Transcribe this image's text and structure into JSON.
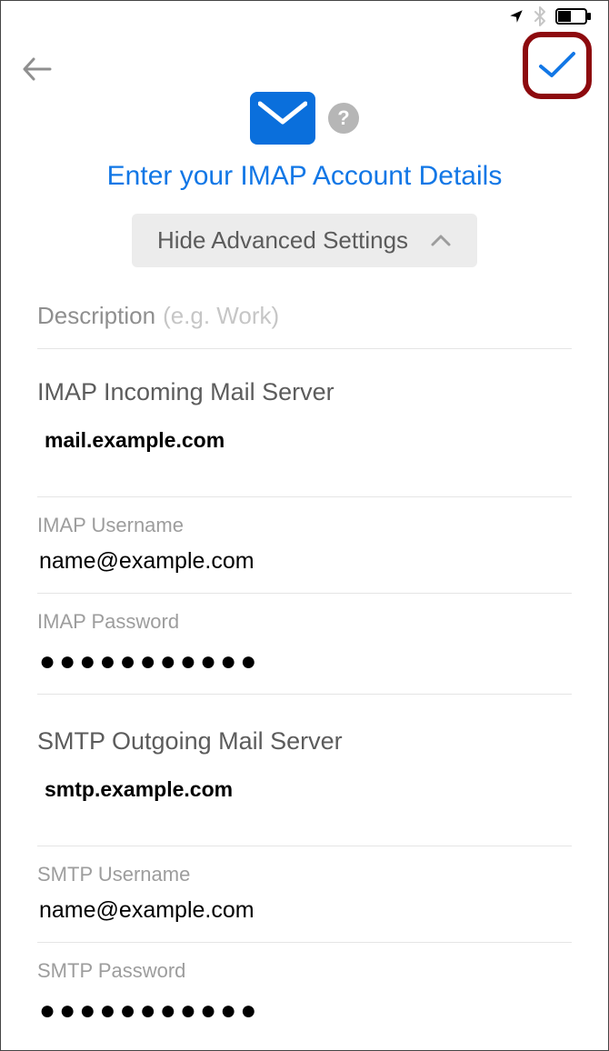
{
  "header": {
    "title": "Enter your IMAP Account Details",
    "toggle_label": "Hide Advanced Settings"
  },
  "description": {
    "label": "Description",
    "placeholder": "(e.g. Work)",
    "value": ""
  },
  "imap": {
    "section_title": "IMAP Incoming Mail Server",
    "host": "mail.example.com",
    "username_label": "IMAP Username",
    "username_value": "name@example.com",
    "password_label": "IMAP Password",
    "password_mask": "●●●●●●●●●●●"
  },
  "smtp": {
    "section_title": "SMTP Outgoing Mail Server",
    "host": "smtp.example.com",
    "username_label": "SMTP Username",
    "username_value": "name@example.com",
    "password_label": "SMTP Password",
    "password_mask": "●●●●●●●●●●●"
  },
  "colors": {
    "accent": "#1277e6",
    "highlight_ring": "#8d0a0e"
  }
}
